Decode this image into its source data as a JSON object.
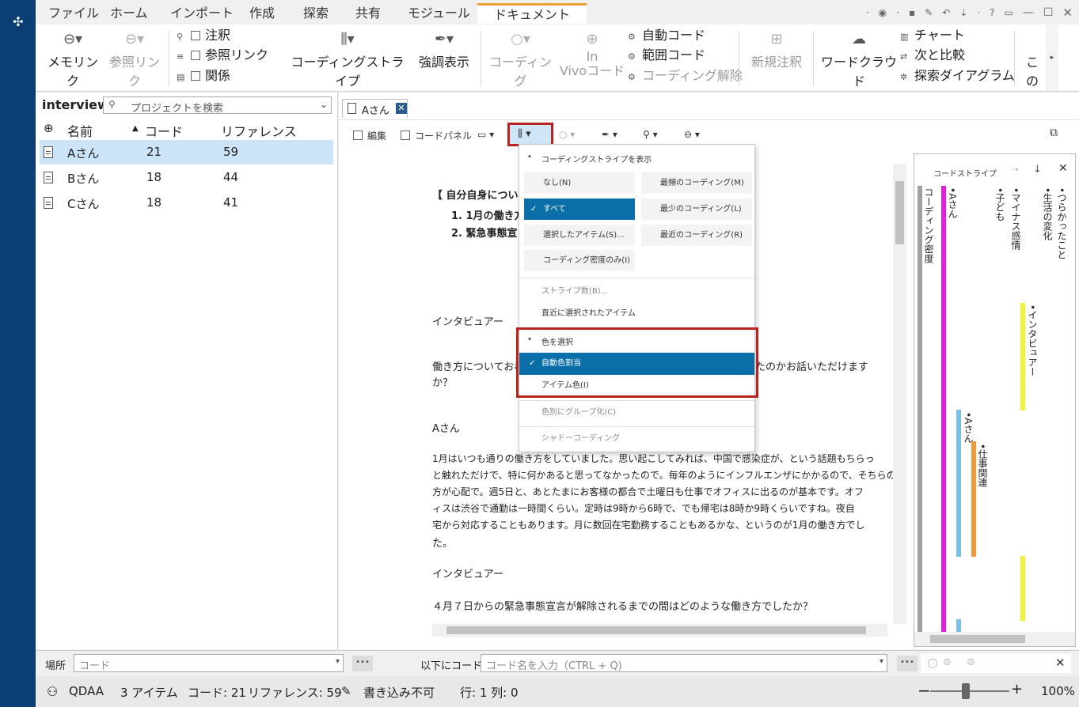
{
  "menu": {
    "tabs": [
      "ファイル",
      "ホーム",
      "インポート",
      "作成",
      "探索",
      "共有",
      "モジュール",
      "ドキュメント"
    ],
    "active": "ドキュメント"
  },
  "ribbon": {
    "memo_link": "メモリンク",
    "ref_link": "参照リンク",
    "annotation": "注釈",
    "ref_link2": "参照リンク",
    "relation": "関係",
    "coding_stripes": "コーディングストライプ",
    "highlight": "強調表示",
    "coding": "コーディング",
    "in": "In",
    "vivo_code": "Vivoコード",
    "auto_code": "自動コード",
    "range_code": "範囲コード",
    "uncode": "コーディング解除",
    "new_annotation": "新規注釈",
    "word_cloud": "ワードクラウド",
    "chart": "チャート",
    "compare_with": "次と比較",
    "explore_diagram": "探索ダイアグラム",
    "this": "この"
  },
  "left_panel": {
    "title": "interview",
    "search_placeholder": "プロジェクトを検索",
    "col_name": "名前",
    "col_code": "コード",
    "col_ref": "リファレンス",
    "rows": [
      {
        "name": "Aさん",
        "code": "21",
        "ref": "59"
      },
      {
        "name": "Bさん",
        "code": "18",
        "ref": "44"
      },
      {
        "name": "Cさん",
        "code": "18",
        "ref": "41"
      }
    ]
  },
  "doc_tab": {
    "label": "Aさん"
  },
  "doc_toolbar": {
    "edit": "編集",
    "code_panel": "コードパネル"
  },
  "document": {
    "heading": "【 自分自身について",
    "li1": "1.   1月の働き方",
    "li2": "2.   緊急事態宣",
    "p1": "インタビュアー",
    "p2": "働き方についてお尋",
    "p2_right": "たのかお話いただけます",
    "p2b": "か？",
    "p3": "Aさん",
    "p4a": "1月はいつも通りの働き方をしていました。思い起こしてみれば、中国で感染症が、という話題もちらっ",
    "p4b": "と触れただけで、特に何かあると思ってなかったので。毎年のようにインフルエンザにかかるので、そちらの",
    "p4c": "方が心配で。週5日と、あとたまにお客様の都合で土曜日も仕事でオフィスに出るのが基本です。オフ",
    "p4d": "ィスは渋谷で通勤は一時間くらい。定時は9時から6時で、でも帰宅は8時か9時くらいですね。夜自",
    "p4e": "宅から対応することもあります。月に数回在宅勤務することもあるかな、というのが1月の働き方でし",
    "p4f": "た。",
    "p5": "インタビュアー",
    "p6": "４月７日からの緊急事態宣言が解除されるまでの間はどのような働き方でしたか？"
  },
  "dropdown": {
    "header1": "コーディングストライプを表示",
    "none": "なし(N)",
    "most_coding": "最頻のコーディング(M)",
    "all": "すべて",
    "least_coding": "最少のコーディング(L)",
    "selected_items": "選択したアイテム(S)...",
    "recent_coding": "最近のコーディング(R)",
    "density_only": "コーディング密度のみ(I)",
    "stripe_count": "ストライプ数(B)...",
    "recent_items": "直近に選択されたアイテム",
    "header2": "色を選択",
    "auto_color": "自動色割当",
    "item_color": "アイテム色(I)",
    "group_by_color": "色別にグループ化(C)",
    "shadow_coding": "シャドーコーディング"
  },
  "stripes_panel": {
    "title": "コードストライプ",
    "labels": [
      "コーディング密度",
      "•Aさん",
      "•子ども",
      "•マイナス感情",
      "•生活の変化",
      "•つらかったこと",
      "•インタビュアー",
      "•Aさん",
      "•仕事関連"
    ]
  },
  "bottom": {
    "location_label": "場所",
    "location_placeholder": "コード",
    "below_code_label": "以下にコード",
    "code_placeholder": "コード名を入力（CTRL + Q)"
  },
  "status": {
    "user": "QDAA",
    "items": "3 アイテム",
    "codes": "コード: 21",
    "refs": "リファレンス: 59",
    "readonly": "書き込み不可",
    "position": "行: 1 列: 0",
    "zoom": "100%"
  }
}
